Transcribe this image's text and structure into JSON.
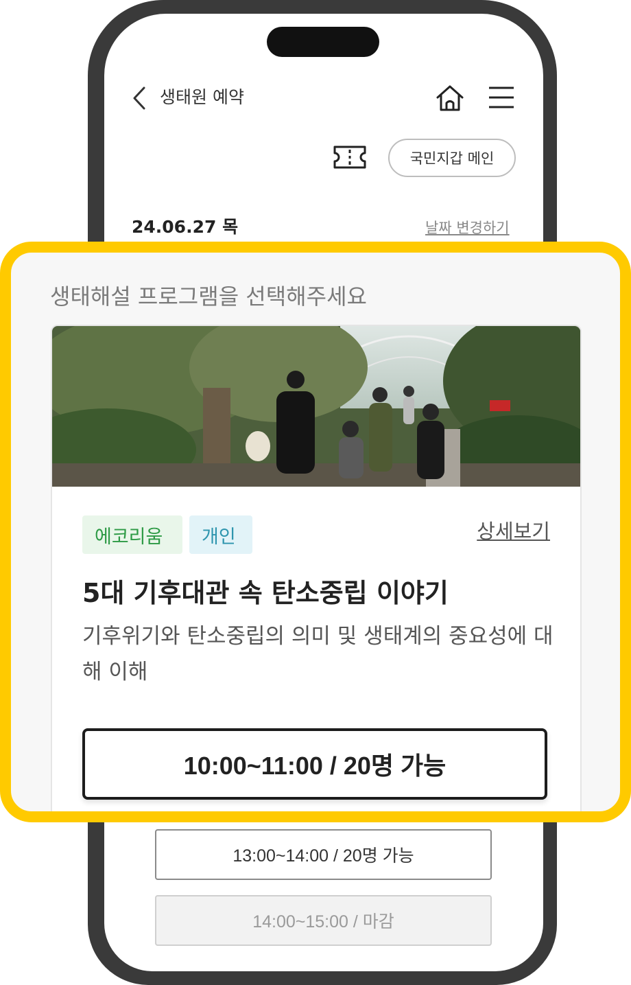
{
  "header": {
    "title": "생태원 예약",
    "wallet_button": "국민지갑 메인"
  },
  "date": {
    "value": "24.06.27 목",
    "change_link": "날짜 변경하기"
  },
  "callout": {
    "heading": "생태해설 프로그램을 선택해주세요"
  },
  "program": {
    "tags": [
      "에코리움",
      "개인"
    ],
    "detail_link": "상세보기",
    "title": "5대 기후대관 속 탄소중립 이야기",
    "description": "기후위기와 탄소중립의 의미 및 생태계의 중요성에 대해 이해"
  },
  "time_slots": [
    {
      "label": "10:00~11:00 / 20명 가능",
      "status": "available"
    },
    {
      "label": "13:00~14:00 / 20명 가능",
      "status": "available"
    },
    {
      "label": "14:00~15:00 / 마감",
      "status": "closed"
    }
  ],
  "colors": {
    "highlight": "#ffca00",
    "tag_green": "#2d9a45",
    "tag_blue": "#2e95ae"
  }
}
